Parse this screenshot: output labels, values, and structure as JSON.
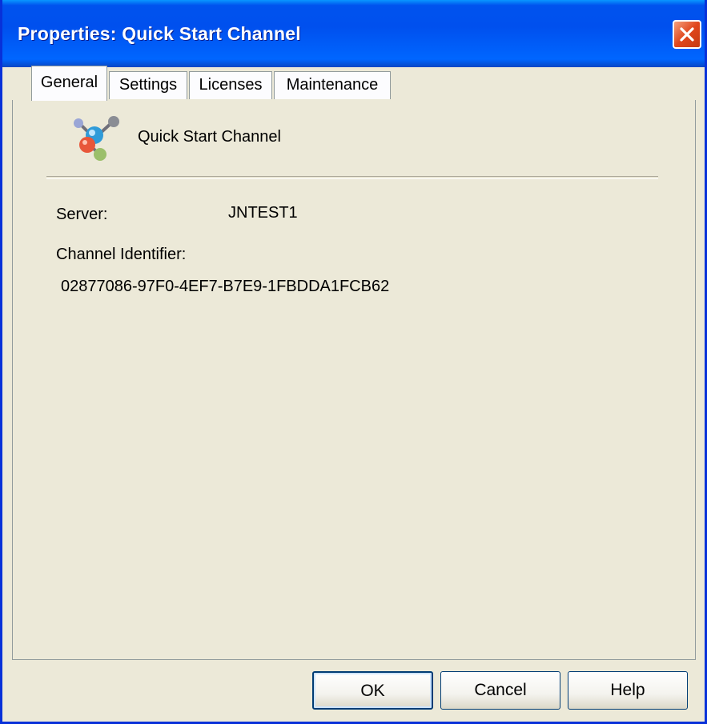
{
  "window": {
    "title": "Properties: Quick Start Channel"
  },
  "tabs": [
    {
      "label": "General",
      "active": true
    },
    {
      "label": "Settings",
      "active": false
    },
    {
      "label": "Licenses",
      "active": false
    },
    {
      "label": "Maintenance",
      "active": false
    }
  ],
  "general": {
    "channel_name": "Quick Start Channel",
    "server_label": "Server:",
    "server_value": "JNTEST1",
    "channel_id_label": "Channel Identifier:",
    "channel_id_value": "02877086-97F0-4EF7-B7E9-1FBDDA1FCB62"
  },
  "buttons": {
    "ok": "OK",
    "cancel": "Cancel",
    "help": "Help"
  },
  "colors": {
    "titlebar": "#0054e3",
    "dialog_bg": "#ece9d8",
    "close_button": "#e0461c"
  },
  "icons": {
    "close": "close-icon",
    "channel": "channel-molecule-icon"
  }
}
